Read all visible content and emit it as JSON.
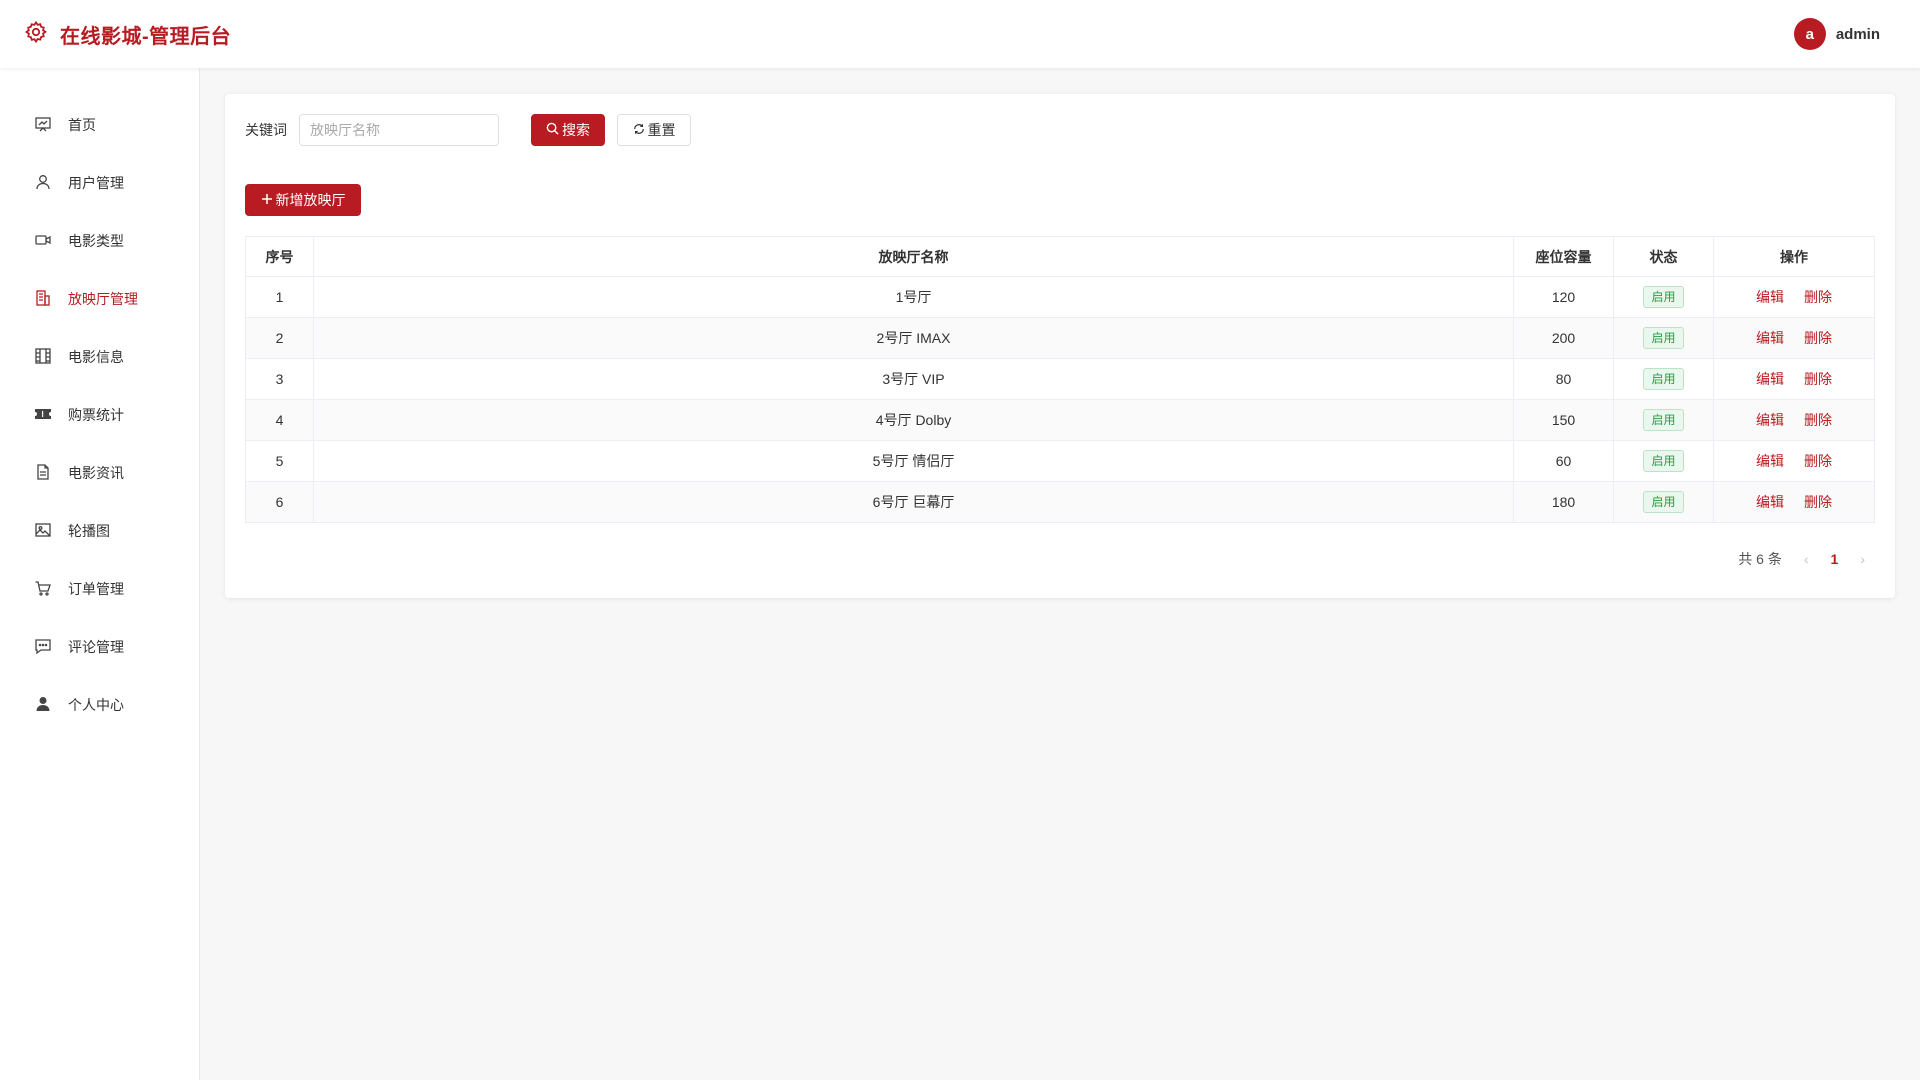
{
  "header": {
    "title": "在线影城-管理后台",
    "avatar_letter": "a",
    "username": "admin"
  },
  "sidebar": {
    "items": [
      {
        "label": "首页",
        "icon": "dashboard-icon"
      },
      {
        "label": "用户管理",
        "icon": "user-icon"
      },
      {
        "label": "电影类型",
        "icon": "video-camera-icon"
      },
      {
        "label": "放映厅管理",
        "icon": "building-icon",
        "active": true
      },
      {
        "label": "电影信息",
        "icon": "film-grid-icon"
      },
      {
        "label": "购票统计",
        "icon": "ticket-icon"
      },
      {
        "label": "电影资讯",
        "icon": "document-icon"
      },
      {
        "label": "轮播图",
        "icon": "image-icon"
      },
      {
        "label": "订单管理",
        "icon": "cart-icon"
      },
      {
        "label": "评论管理",
        "icon": "chat-icon"
      },
      {
        "label": "个人中心",
        "icon": "person-icon"
      }
    ]
  },
  "search": {
    "label": "关键词",
    "placeholder": "放映厅名称",
    "value": "",
    "search_label": "搜索",
    "reset_label": "重置"
  },
  "add_label": "新增放映厅",
  "table": {
    "headers": [
      "序号",
      "放映厅名称",
      "座位容量",
      "状态",
      "操作"
    ],
    "rows": [
      {
        "index": "1",
        "name": "1号厅",
        "seats": "120",
        "status": "启用"
      },
      {
        "index": "2",
        "name": "2号厅 IMAX",
        "seats": "200",
        "status": "启用"
      },
      {
        "index": "3",
        "name": "3号厅 VIP",
        "seats": "80",
        "status": "启用"
      },
      {
        "index": "4",
        "name": "4号厅 Dolby",
        "seats": "150",
        "status": "启用"
      },
      {
        "index": "5",
        "name": "5号厅 情侣厅",
        "seats": "60",
        "status": "启用"
      },
      {
        "index": "6",
        "name": "6号厅 巨幕厅",
        "seats": "180",
        "status": "启用"
      }
    ],
    "edit_label": "编辑",
    "delete_label": "删除"
  },
  "pagination": {
    "total_text": "共 6 条",
    "current_page": "1",
    "prev": "‹",
    "next": "›"
  },
  "colors": {
    "primary": "#b81c22",
    "success": "#2a9d48"
  }
}
